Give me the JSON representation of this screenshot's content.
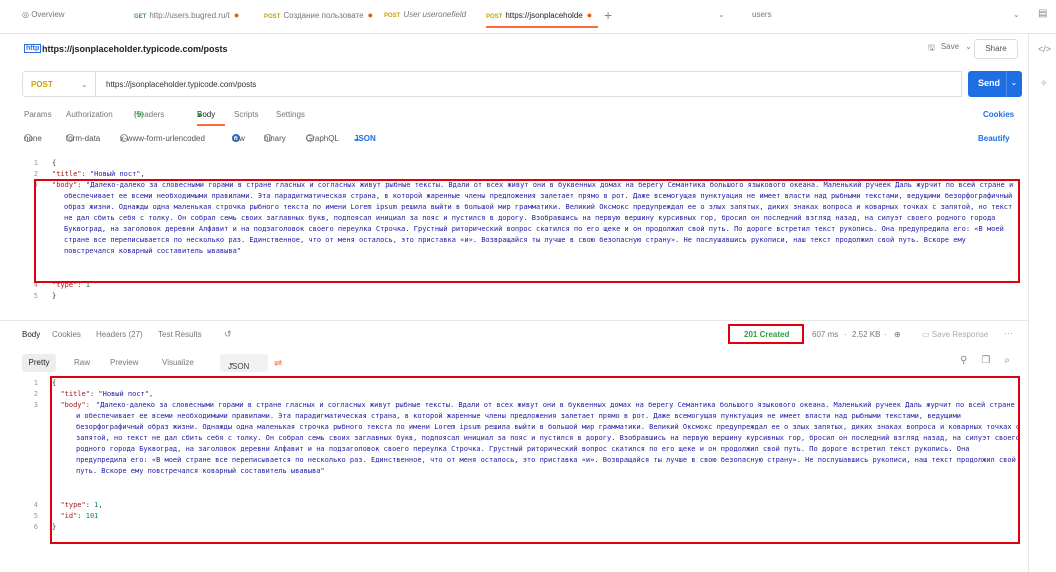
{
  "tabs": [
    {
      "method": "",
      "label": "Overview",
      "modified": false,
      "italic": false
    },
    {
      "method": "GET",
      "label": "http://users.bugred.ru/t",
      "modified": true,
      "italic": false
    },
    {
      "method": "POST",
      "label": "Создание пользовате",
      "modified": true,
      "italic": false
    },
    {
      "method": "POST",
      "label": "User useronefield",
      "modified": false,
      "italic": true
    },
    {
      "method": "POST",
      "label": "https://jsonplaceholde",
      "modified": true,
      "italic": false
    }
  ],
  "environment": {
    "name": "users"
  },
  "request": {
    "title": "https://jsonplaceholder.typicode.com/posts",
    "method": "POST",
    "url": "https://jsonplaceholder.typicode.com/posts",
    "save_label": "Save",
    "share_label": "Share",
    "send_label": "Send",
    "api_icon_text": "http",
    "tabs": {
      "params": "Params",
      "authorization": "Authorization",
      "headers": "Headers",
      "headers_count": "(9)",
      "body": "Body",
      "scripts": "Scripts",
      "settings": "Settings"
    },
    "cookies_label": "Cookies",
    "beautify_label": "Beautify",
    "body_types": {
      "none": "none",
      "form_data": "form-data",
      "urlencoded": "x-www-form-urlencoded",
      "raw": "raw",
      "binary": "binary",
      "graphql": "GraphQL",
      "format": "JSON"
    }
  },
  "json": {
    "title_key": "\"title\"",
    "title_value": "\"Новый пост\"",
    "body_key": "\"body\"",
    "body_value": "\"Далеко-далеко за словесными горами в стране гласных и согласных живут рыбные тексты. Вдали от всех живут они в буквенных домах на берегу Семантика большого языкового океана. Маленький ручеек Даль журчит по всей стране и обеспечивает ее всеми необходимыми правилами. Эта парадигматическая страна, в которой жаренные члены предложения залетает прямо в рот. Даже всемогущая пунктуация не имеет власти над рыбными текстами, ведущими безорфографичный образ жизни. Однажды одна маленькая строчка рыбного текста по имени Lorem ipsum решила выйти в большой мир грамматики. Великий Оксмокс предупреждал ее о злых запятых, диких знаках вопроса и коварных точках с запятой, но текст не дал сбить себя с толку. Он собрал семь своих заглавных букв, подпоясал инициал за пояс и пустился в дорогу. Взобравшись на первую вершину курсивных гор, бросил он последний взгляд назад, на силуэт своего родного города Буквоград, на заголовок деревни Алфавит и на подзаголовок своего переулка Строчка. Грустный риторический вопрос скатился по его щеке и он продолжил свой путь. По дороге встретил текст рукопись. Она предупредила его: «В моей стране все переписывается по несколько раз. Единственное, что от меня осталось, это приставка «и». Возвращайся ты лучше в свою безопасную страну». Не послушавшись рукописи, наш текст продолжил свой путь. Вскоре ему повстречался коварный составитель ывавыва\"",
    "type_key": "\"type\"",
    "type_value": "1",
    "id_key": "\"id\"",
    "id_value": "101"
  },
  "response": {
    "tabs": {
      "body": "Body",
      "cookies": "Cookies",
      "headers": "Headers (27)",
      "test_results": "Test Results"
    },
    "status": "201 Created",
    "time": "607 ms",
    "size": "2.52 KB",
    "save_response": "Save Response",
    "view_modes": {
      "pretty": "Pretty",
      "raw": "Raw",
      "preview": "Preview",
      "visualize": "Visualize",
      "format": "JSON"
    }
  },
  "icons": {
    "overview": "overview-icon",
    "history": "history-icon",
    "globe": "globe-icon",
    "copy": "copy-icon",
    "search": "search-icon",
    "link": "link-icon",
    "wrap": "wrap-lines-icon"
  }
}
